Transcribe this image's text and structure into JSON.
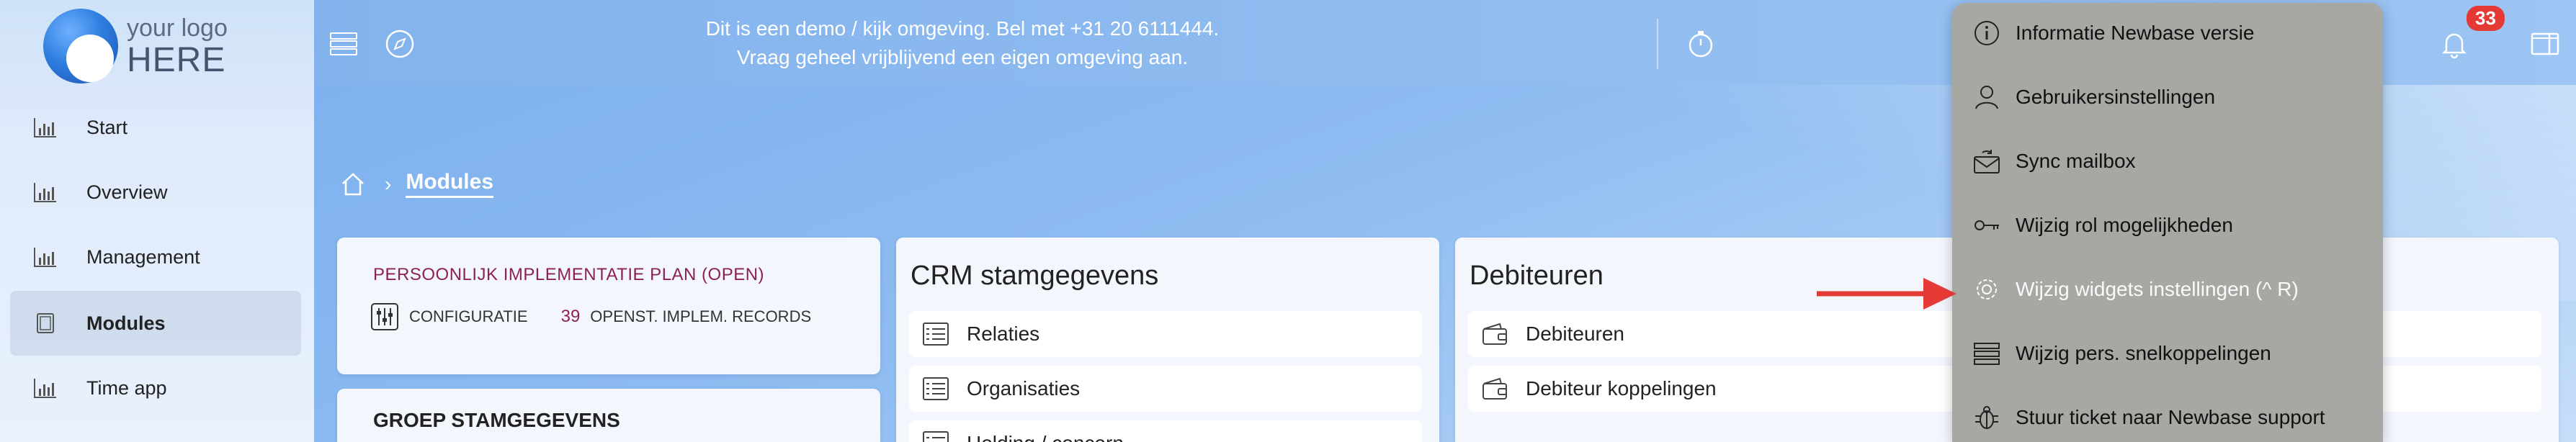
{
  "logo": {
    "line1": "your logo",
    "line2": "HERE"
  },
  "sidebar": {
    "items": [
      {
        "label": "Start",
        "active": false
      },
      {
        "label": "Overview",
        "active": false
      },
      {
        "label": "Management",
        "active": false
      },
      {
        "label": "Modules",
        "active": true
      },
      {
        "label": "Time app",
        "active": false
      }
    ]
  },
  "topbar": {
    "demo_line1": "Dit is een demo / kijk omgeving. Bel met +31 20 6111444.",
    "demo_line2": "Vraag geheel vrijblijvend een eigen omgeving aan.",
    "notification_count": "33"
  },
  "breadcrumb": {
    "current": "Modules"
  },
  "pip_card": {
    "title": "PERSOONLIJK IMPLEMENTATIE PLAN (OPEN)",
    "config_label": "CONFIGURATIE",
    "count": "39",
    "records_label": "OPENST. IMPLEM. RECORDS"
  },
  "groep_card": {
    "title": "GROEP STAMGEGEVENS"
  },
  "crm_card": {
    "title": "CRM stamgegevens",
    "items": [
      "Relaties",
      "Organisaties",
      "Holding / concern"
    ]
  },
  "debiteuren_card": {
    "title": "Debiteuren",
    "items": [
      "Debiteuren",
      "Debiteur koppelingen"
    ]
  },
  "dropdown": {
    "items": [
      {
        "label": "Informatie Newbase versie",
        "icon": "info-icon"
      },
      {
        "label": "Gebruikersinstellingen",
        "icon": "user-icon"
      },
      {
        "label": "Sync mailbox",
        "icon": "mail-sync-icon"
      },
      {
        "label": "Wijzig rol mogelijkheden",
        "icon": "key-icon"
      },
      {
        "label": "Wijzig widgets instellingen (^ R)",
        "icon": "gear-icon"
      },
      {
        "label": "Wijzig pers. snelkoppelingen",
        "icon": "list-icon"
      },
      {
        "label": "Stuur ticket naar Newbase support",
        "icon": "bug-icon"
      }
    ]
  },
  "colors": {
    "accent_arrow": "#e53935",
    "badge": "#e53935",
    "pip_text": "#8b2252",
    "dropdown_bg": "#a7a7a4"
  }
}
